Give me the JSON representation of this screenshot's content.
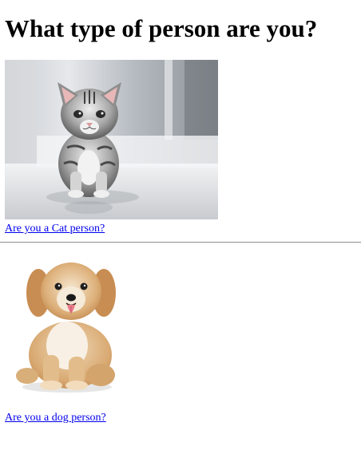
{
  "page": {
    "heading": "What type of person are you?"
  },
  "cat_section": {
    "image": "cat-photo",
    "link_label": "Are you a Cat person?"
  },
  "dog_section": {
    "image": "dog-photo",
    "link_label": "Are you a dog person?"
  },
  "colors": {
    "link": "#0000ee",
    "divider": "#9a9a9a",
    "background": "#ffffff"
  }
}
